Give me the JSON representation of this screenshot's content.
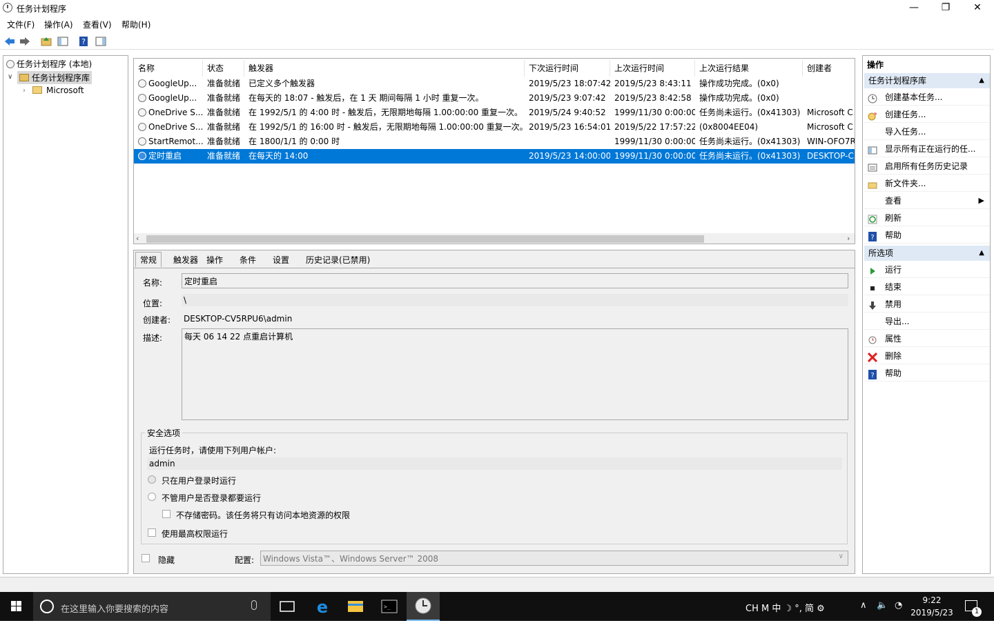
{
  "window": {
    "title": "任务计划程序",
    "min": "—",
    "max": "❐",
    "close": "✕"
  },
  "menu": [
    "文件(F)",
    "操作(A)",
    "查看(V)",
    "帮助(H)"
  ],
  "tree": {
    "root": "任务计划程序 (本地)",
    "lib": "任务计划程序库",
    "child": "Microsoft"
  },
  "list": {
    "headers": [
      "名称",
      "状态",
      "触发器",
      "下次运行时间",
      "上次运行时间",
      "上次运行结果",
      "创建者"
    ],
    "rows": [
      [
        "GoogleUp...",
        "准备就绪",
        "已定义多个触发器",
        "2019/5/23 18:07:42",
        "2019/5/23 8:43:11",
        "操作成功完成。(0x0)",
        ""
      ],
      [
        "GoogleUp...",
        "准备就绪",
        "在每天的 18:07 - 触发后，在 1 天 期间每隔 1 小时 重复一次。",
        "2019/5/23 9:07:42",
        "2019/5/23 8:42:58",
        "操作成功完成。(0x0)",
        ""
      ],
      [
        "OneDrive S...",
        "准备就绪",
        "在 1992/5/1 的 4:00 时 - 触发后，无限期地每隔 1.00:00:00 重复一次。",
        "2019/5/24 9:40:52",
        "1999/11/30 0:00:00",
        "任务尚未运行。(0x41303)",
        "Microsoft C"
      ],
      [
        "OneDrive S...",
        "准备就绪",
        "在 1992/5/1 的 16:00 时 - 触发后，无限期地每隔 1.00:00:00 重复一次。",
        "2019/5/23 16:54:01",
        "2019/5/22 17:57:22",
        "(0x8004EE04)",
        "Microsoft C"
      ],
      [
        "StartRemot...",
        "准备就绪",
        "在 1800/1/1 的 0:00 时",
        "",
        "1999/11/30 0:00:00",
        "任务尚未运行。(0x41303)",
        "WIN-OFO7R"
      ],
      [
        "定时重启",
        "准备就绪",
        "在每天的 14:00",
        "2019/5/23 14:00:00",
        "1999/11/30 0:00:00",
        "任务尚未运行。(0x41303)",
        "DESKTOP-C"
      ]
    ]
  },
  "tabs": [
    "常规",
    "触发器",
    "操作",
    "条件",
    "设置",
    "历史记录(已禁用)"
  ],
  "general": {
    "name_label": "名称:",
    "name_value": "定时重启",
    "location_label": "位置:",
    "location_value": "\\",
    "author_label": "创建者:",
    "author_value": "DESKTOP-CV5RPU6\\admin",
    "desc_label": "描述:",
    "desc_value": "每天 06 14 22 点重启计算机",
    "security_title": "安全选项",
    "run_as_label": "运行任务时，请使用下列用户帐户:",
    "run_as_value": "admin",
    "opt1": "只在用户登录时运行",
    "opt2": "不管用户是否登录都要运行",
    "opt3": "不存储密码。该任务将只有访问本地资源的权限",
    "opt4": "使用最高权限运行",
    "hidden": "隐藏",
    "config_label": "配置:",
    "config_value": "Windows Vista™、Windows Server™ 2008"
  },
  "actions": {
    "title": "操作",
    "group1": "任务计划程序库",
    "items1": [
      "创建基本任务...",
      "创建任务...",
      "导入任务...",
      "显示所有正在运行的任...",
      "启用所有任务历史记录",
      "新文件夹...",
      "查看",
      "刷新",
      "帮助"
    ],
    "group2": "所选项",
    "items2": [
      "运行",
      "结束",
      "禁用",
      "导出...",
      "属性",
      "删除",
      "帮助"
    ]
  },
  "taskbar": {
    "search": "在这里输入你要搜索的内容",
    "tray": "CH M 中 ☽ °, 简 ⚙",
    "time": "9:22",
    "date": "2019/5/23",
    "notif": "1"
  }
}
